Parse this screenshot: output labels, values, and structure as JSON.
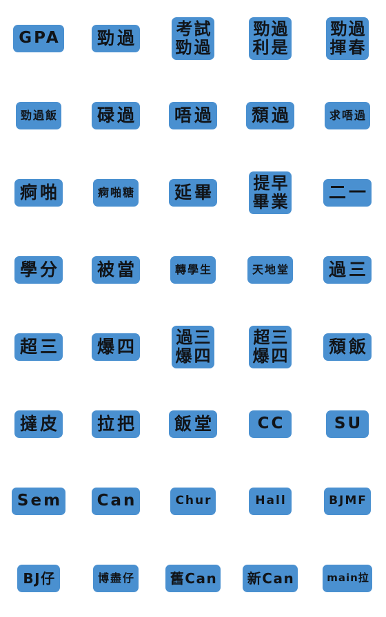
{
  "sheet": {
    "title": "Hong Kong University Slang Emoji Sticker Set",
    "columns": 5,
    "rows": 8,
    "sticker_color": "#4a90d0",
    "text_color": "#111418",
    "background_color": "#ffffff",
    "total_stickers": 40
  },
  "stickers": [
    {
      "id": 1,
      "row": 1,
      "col": 1,
      "lines": [
        "GPA"
      ],
      "style": "latin",
      "script": "latin"
    },
    {
      "id": 2,
      "row": 1,
      "col": 2,
      "lines": [
        "勁過"
      ],
      "style": "cjk2",
      "script": "cjk"
    },
    {
      "id": 3,
      "row": 1,
      "col": 3,
      "lines": [
        "考試",
        "勁過"
      ],
      "style": "two-line",
      "script": "cjk"
    },
    {
      "id": 4,
      "row": 1,
      "col": 4,
      "lines": [
        "勁過",
        "利是"
      ],
      "style": "two-line",
      "script": "cjk"
    },
    {
      "id": 5,
      "row": 1,
      "col": 5,
      "lines": [
        "勁過",
        "揮春"
      ],
      "style": "two-line",
      "script": "cjk"
    },
    {
      "id": 6,
      "row": 2,
      "col": 1,
      "lines": [
        "勁過飯"
      ],
      "style": "cjk3",
      "script": "cjk"
    },
    {
      "id": 7,
      "row": 2,
      "col": 2,
      "lines": [
        "碌過"
      ],
      "style": "cjk2",
      "script": "cjk"
    },
    {
      "id": 8,
      "row": 2,
      "col": 3,
      "lines": [
        "唔過"
      ],
      "style": "cjk2",
      "script": "cjk"
    },
    {
      "id": 9,
      "row": 2,
      "col": 4,
      "lines": [
        "頹過"
      ],
      "style": "cjk2",
      "script": "cjk"
    },
    {
      "id": 10,
      "row": 2,
      "col": 5,
      "lines": [
        "求唔過"
      ],
      "style": "cjk3",
      "script": "cjk"
    },
    {
      "id": 11,
      "row": 3,
      "col": 1,
      "lines": [
        "痾啪"
      ],
      "style": "cjk2",
      "script": "cjk"
    },
    {
      "id": 12,
      "row": 3,
      "col": 2,
      "lines": [
        "痾啪糖"
      ],
      "style": "cjk3",
      "script": "cjk"
    },
    {
      "id": 13,
      "row": 3,
      "col": 3,
      "lines": [
        "延畢"
      ],
      "style": "cjk2",
      "script": "cjk"
    },
    {
      "id": 14,
      "row": 3,
      "col": 4,
      "lines": [
        "提早",
        "畢業"
      ],
      "style": "two-line",
      "script": "cjk"
    },
    {
      "id": 15,
      "row": 3,
      "col": 5,
      "lines": [
        "二一"
      ],
      "style": "cjk2",
      "script": "cjk"
    },
    {
      "id": 16,
      "row": 4,
      "col": 1,
      "lines": [
        "學分"
      ],
      "style": "cjk2",
      "script": "cjk"
    },
    {
      "id": 17,
      "row": 4,
      "col": 2,
      "lines": [
        "被當"
      ],
      "style": "cjk2",
      "script": "cjk"
    },
    {
      "id": 18,
      "row": 4,
      "col": 3,
      "lines": [
        "轉學生"
      ],
      "style": "cjk3",
      "script": "cjk"
    },
    {
      "id": 19,
      "row": 4,
      "col": 4,
      "lines": [
        "天地堂"
      ],
      "style": "cjk3",
      "script": "cjk"
    },
    {
      "id": 20,
      "row": 4,
      "col": 5,
      "lines": [
        "過三"
      ],
      "style": "cjk2",
      "script": "cjk"
    },
    {
      "id": 21,
      "row": 5,
      "col": 1,
      "lines": [
        "超三"
      ],
      "style": "cjk2",
      "script": "cjk"
    },
    {
      "id": 22,
      "row": 5,
      "col": 2,
      "lines": [
        "爆四"
      ],
      "style": "cjk2",
      "script": "cjk"
    },
    {
      "id": 23,
      "row": 5,
      "col": 3,
      "lines": [
        "過三",
        "爆四"
      ],
      "style": "two-line",
      "script": "cjk"
    },
    {
      "id": 24,
      "row": 5,
      "col": 4,
      "lines": [
        "超三",
        "爆四"
      ],
      "style": "two-line",
      "script": "cjk"
    },
    {
      "id": 25,
      "row": 5,
      "col": 5,
      "lines": [
        "頹飯"
      ],
      "style": "cjk2",
      "script": "cjk"
    },
    {
      "id": 26,
      "row": 6,
      "col": 1,
      "lines": [
        "撻皮"
      ],
      "style": "cjk2",
      "script": "cjk"
    },
    {
      "id": 27,
      "row": 6,
      "col": 2,
      "lines": [
        "拉把"
      ],
      "style": "cjk2",
      "script": "cjk"
    },
    {
      "id": 28,
      "row": 6,
      "col": 3,
      "lines": [
        "飯堂"
      ],
      "style": "cjk2",
      "script": "cjk"
    },
    {
      "id": 29,
      "row": 6,
      "col": 4,
      "lines": [
        "CC"
      ],
      "style": "latin",
      "script": "latin"
    },
    {
      "id": 30,
      "row": 6,
      "col": 5,
      "lines": [
        "SU"
      ],
      "style": "latin",
      "script": "latin"
    },
    {
      "id": 31,
      "row": 7,
      "col": 1,
      "lines": [
        "Sem"
      ],
      "style": "latin",
      "script": "latin"
    },
    {
      "id": 32,
      "row": 7,
      "col": 2,
      "lines": [
        "Can"
      ],
      "style": "latin",
      "script": "latin"
    },
    {
      "id": 33,
      "row": 7,
      "col": 3,
      "lines": [
        "Chur"
      ],
      "style": "latin-sm",
      "script": "latin"
    },
    {
      "id": 34,
      "row": 7,
      "col": 4,
      "lines": [
        "Hall"
      ],
      "style": "latin-sm",
      "script": "latin"
    },
    {
      "id": 35,
      "row": 7,
      "col": 5,
      "lines": [
        "BJMF"
      ],
      "style": "latin-sm",
      "script": "latin"
    },
    {
      "id": 36,
      "row": 8,
      "col": 1,
      "lines": [
        "BJ仔"
      ],
      "style": "mixed",
      "script": "mixed"
    },
    {
      "id": 37,
      "row": 8,
      "col": 2,
      "lines": [
        "博盡仔"
      ],
      "style": "cjk3",
      "script": "cjk"
    },
    {
      "id": 38,
      "row": 8,
      "col": 3,
      "lines": [
        "舊Can"
      ],
      "style": "mixed",
      "script": "mixed"
    },
    {
      "id": 39,
      "row": 8,
      "col": 4,
      "lines": [
        "新Can"
      ],
      "style": "mixed",
      "script": "mixed"
    },
    {
      "id": 40,
      "row": 8,
      "col": 5,
      "lines": [
        "main拉"
      ],
      "style": "mixed-sm",
      "script": "mixed"
    }
  ]
}
